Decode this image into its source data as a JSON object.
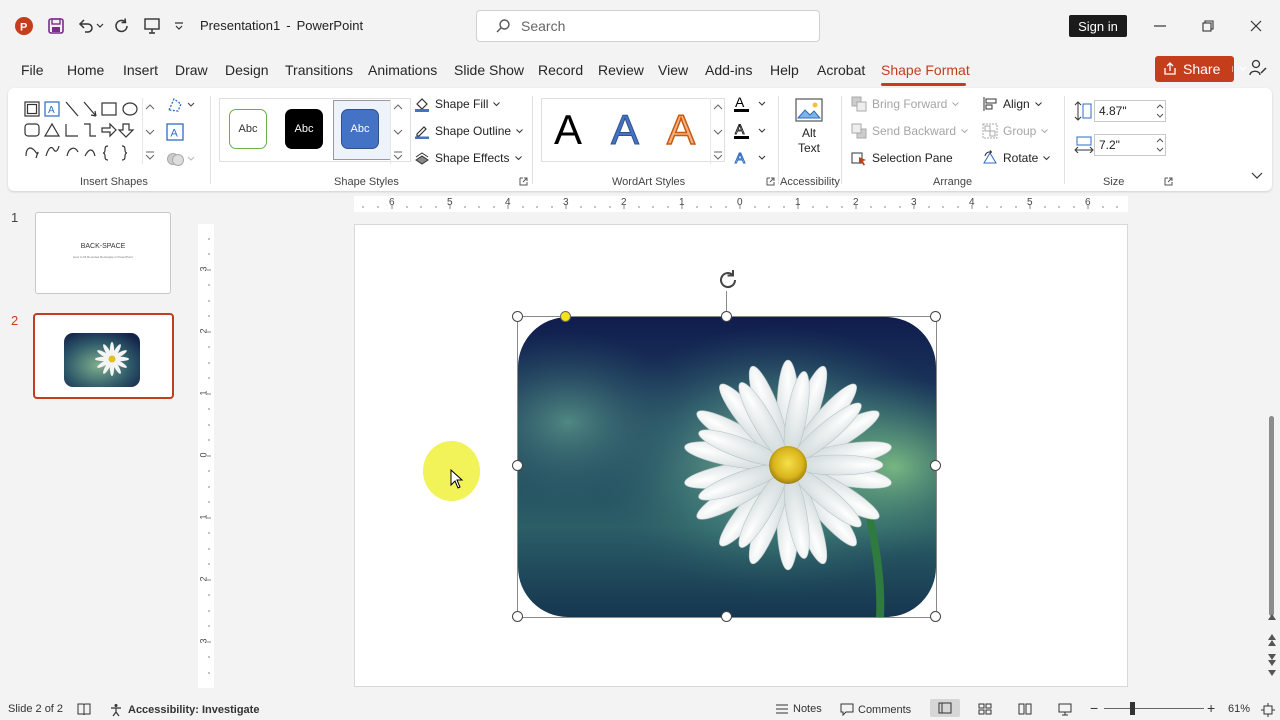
{
  "app": {
    "file_name": "Presentation1",
    "separator": "-",
    "app_name": "PowerPoint"
  },
  "search": {
    "placeholder": "Search"
  },
  "account": {
    "sign_in_label": "Sign in"
  },
  "menu_tabs": [
    "File",
    "Home",
    "Insert",
    "Draw",
    "Design",
    "Transitions",
    "Animations",
    "Slide Show",
    "Record",
    "Review",
    "View",
    "Add-ins",
    "Help",
    "Acrobat",
    "Shape Format"
  ],
  "active_tab": "Shape Format",
  "share_label": "Share",
  "ribbon": {
    "groups": {
      "insert_shapes": "Insert Shapes",
      "shape_styles": "Shape Styles",
      "wordart_styles": "WordArt Styles",
      "accessibility": "Accessibility",
      "arrange": "Arrange",
      "size": "Size"
    },
    "style_presets": [
      "Abc",
      "Abc",
      "Abc"
    ],
    "shape_fill": "Shape Fill",
    "shape_outline": "Shape Outline",
    "shape_effects": "Shape Effects",
    "wordart_letters": [
      "A",
      "A",
      "A"
    ],
    "alt_text_line1": "Alt",
    "alt_text_line2": "Text",
    "bring_forward": "Bring Forward",
    "send_backward": "Send Backward",
    "selection_pane": "Selection Pane",
    "align": "Align",
    "group": "Group",
    "rotate": "Rotate",
    "height": "4.87\"",
    "width": "7.2\""
  },
  "slides": [
    {
      "number": "1",
      "title": "BACK-SPACE",
      "subtitle": "How to fill Rounded Rectangle in PowerPoint"
    },
    {
      "number": "2"
    }
  ],
  "ruler": {
    "horizontal": [
      "6",
      "5",
      "4",
      "3",
      "2",
      "1",
      "0",
      "1",
      "2",
      "3",
      "4",
      "5",
      "6"
    ],
    "vertical": [
      "3",
      "2",
      "1",
      "0",
      "1",
      "2",
      "3"
    ]
  },
  "status": {
    "slide_info": "Slide 2 of 2",
    "accessibility": "Accessibility: Investigate",
    "notes": "Notes",
    "comments": "Comments",
    "zoom": "61%"
  },
  "colors": {
    "accent": "#c43e1c",
    "ribbon_bg": "#ffffff",
    "window_bg": "#f3f3f3"
  }
}
